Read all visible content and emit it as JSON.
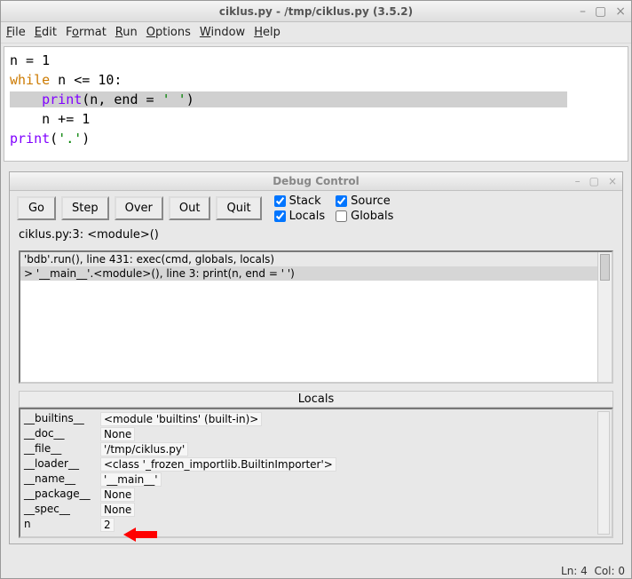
{
  "window": {
    "title": "ciklus.py - /tmp/ciklus.py (3.5.2)",
    "controls": {
      "min": "–",
      "max": "▢",
      "close": "×"
    }
  },
  "menu": {
    "file": "File",
    "edit": "Edit",
    "format": "Format",
    "run": "Run",
    "options": "Options",
    "window": "Window",
    "help": "Help"
  },
  "code": {
    "l1a": "n = ",
    "l1b": "1",
    "l2a": "while",
    "l2b": " n <= ",
    "l2c": "10",
    "l2d": ":",
    "l3indent": "    ",
    "l3a": "print",
    "l3b": "(n, end = ",
    "l3c": "' '",
    "l3d": ")",
    "l4indent": "    ",
    "l4a": "n += ",
    "l4b": "1",
    "l5a": "print",
    "l5b": "(",
    "l5c": "'.'",
    "l5d": ")"
  },
  "debug": {
    "title": "Debug Control",
    "buttons": {
      "go": "Go",
      "step": "Step",
      "over": "Over",
      "out": "Out",
      "quit": "Quit"
    },
    "checks": {
      "stack": "Stack",
      "source": "Source",
      "locals": "Locals",
      "globals": "Globals"
    },
    "checked": {
      "stack": true,
      "source": true,
      "locals": true,
      "globals": false
    },
    "status": "ciklus.py:3: <module>()",
    "stack": [
      "'bdb'.run(), line 431: exec(cmd, globals, locals)",
      "> '__main__'.<module>(), line 3: print(n, end = ' ')"
    ],
    "locals_header": "Locals",
    "locals": [
      {
        "k": "__builtins__",
        "v": "<module 'builtins' (built-in)>"
      },
      {
        "k": "__doc__",
        "v": "None"
      },
      {
        "k": "__file__",
        "v": "'/tmp/ciklus.py'"
      },
      {
        "k": "__loader__",
        "v": "<class '_frozen_importlib.BuiltinImporter'>"
      },
      {
        "k": "__name__",
        "v": "'__main__'"
      },
      {
        "k": "__package__",
        "v": "None"
      },
      {
        "k": "__spec__",
        "v": "None"
      },
      {
        "k": "n",
        "v": "2"
      }
    ]
  },
  "statusbar": {
    "line": "Ln: 4",
    "col": "Col: 0"
  }
}
